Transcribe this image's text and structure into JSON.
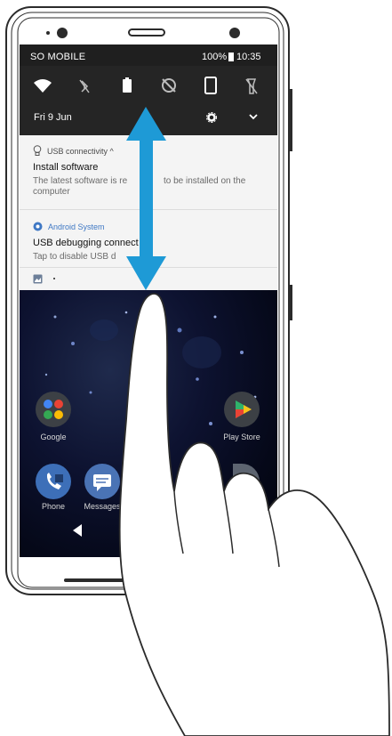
{
  "status_bar": {
    "carrier": "SO MOBILE",
    "battery": "100%",
    "time": "10:35"
  },
  "quick_settings": {
    "date": "Fri 9 Jun",
    "tiles": [
      "wifi-icon",
      "bluetooth-off-icon",
      "flashlight-icon",
      "auto-rotate-icon",
      "stamina-icon",
      "torch-off-icon"
    ]
  },
  "notifications": [
    {
      "app": "USB connectivity ^",
      "title": "Install software",
      "body_line1": "The latest software is re",
      "body_line1_end": "to be installed on the",
      "body_line2": "computer"
    },
    {
      "app": "Android System",
      "title": "USB debugging connect",
      "body": "Tap to disable USB d"
    }
  ],
  "home": {
    "apps": [
      {
        "label": "Google"
      },
      {
        "label": "Play Store"
      },
      {
        "label": "Phone"
      },
      {
        "label": "Messages"
      }
    ]
  },
  "colors": {
    "status_bg": "#1f1f1f",
    "shade_bg": "#f4f4f4",
    "arrow": "#1e9ad6",
    "android_system_blue": "#3f78c4"
  }
}
